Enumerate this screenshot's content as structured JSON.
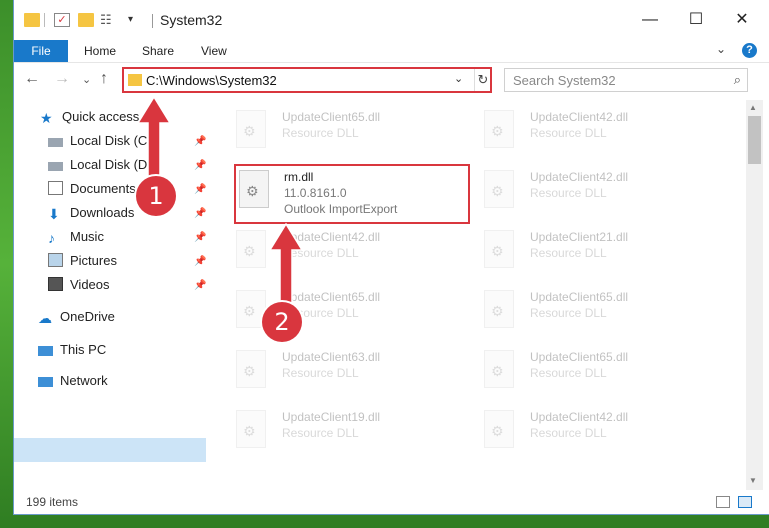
{
  "titlebar": {
    "title": "System32",
    "minimize": "—",
    "maximize": "☐",
    "close": "✕"
  },
  "ribbon": {
    "tabs": [
      "File",
      "Home",
      "Share",
      "View"
    ],
    "expand": "⌄",
    "help": "?"
  },
  "address": {
    "path": "C:\\Windows\\System32",
    "dropdown": "⌄",
    "refresh": "↻"
  },
  "nav_buttons": {
    "back": "←",
    "forward": "→",
    "recent": "⌄",
    "up": "↑"
  },
  "search": {
    "placeholder": "Search System32",
    "icon": "⌕"
  },
  "nav": {
    "quick_access": "Quick access",
    "items": [
      {
        "label": "Local Disk (C:)",
        "icon": "drive-icon"
      },
      {
        "label": "Local Disk (D:)",
        "icon": "drive-icon"
      },
      {
        "label": "Documents",
        "icon": "documents-icon"
      },
      {
        "label": "Downloads",
        "icon": "downloads-icon"
      },
      {
        "label": "Music",
        "icon": "music-icon"
      },
      {
        "label": "Pictures",
        "icon": "pictures-icon"
      },
      {
        "label": "Videos",
        "icon": "videos-icon"
      }
    ],
    "onedrive": "OneDrive",
    "this_pc": "This PC",
    "network": "Network"
  },
  "files": {
    "left": [
      {
        "name": "UpdateClient65.dll",
        "desc": "Resource DLL"
      },
      {
        "name": "rm.dll",
        "desc": "11.0.8161.0",
        "desc2": "Outlook ImportExport"
      },
      {
        "name": "UpdateClient42.dll",
        "desc": "Resource DLL"
      },
      {
        "name": "UpdateClient65.dll",
        "desc": "Resource DLL"
      },
      {
        "name": "UpdateClient63.dll",
        "desc": "Resource DLL"
      },
      {
        "name": "UpdateClient19.dll",
        "desc": "Resource DLL"
      }
    ],
    "right": [
      {
        "name": "UpdateClient42.dll",
        "desc": "Resource DLL"
      },
      {
        "name": "UpdateClient42.dll",
        "desc": "Resource DLL"
      },
      {
        "name": "UpdateClient21.dll",
        "desc": "Resource DLL"
      },
      {
        "name": "UpdateClient65.dll",
        "desc": "Resource DLL"
      },
      {
        "name": "UpdateClient65.dll",
        "desc": "Resource DLL"
      },
      {
        "name": "UpdateClient42.dll",
        "desc": "Resource DLL"
      }
    ]
  },
  "status": {
    "count": "199 items"
  },
  "annotations": {
    "callout1": "1",
    "callout2": "2"
  },
  "colors": {
    "accent": "#1979ca",
    "annotation": "#d9363e",
    "selection": "#cce4f7"
  }
}
